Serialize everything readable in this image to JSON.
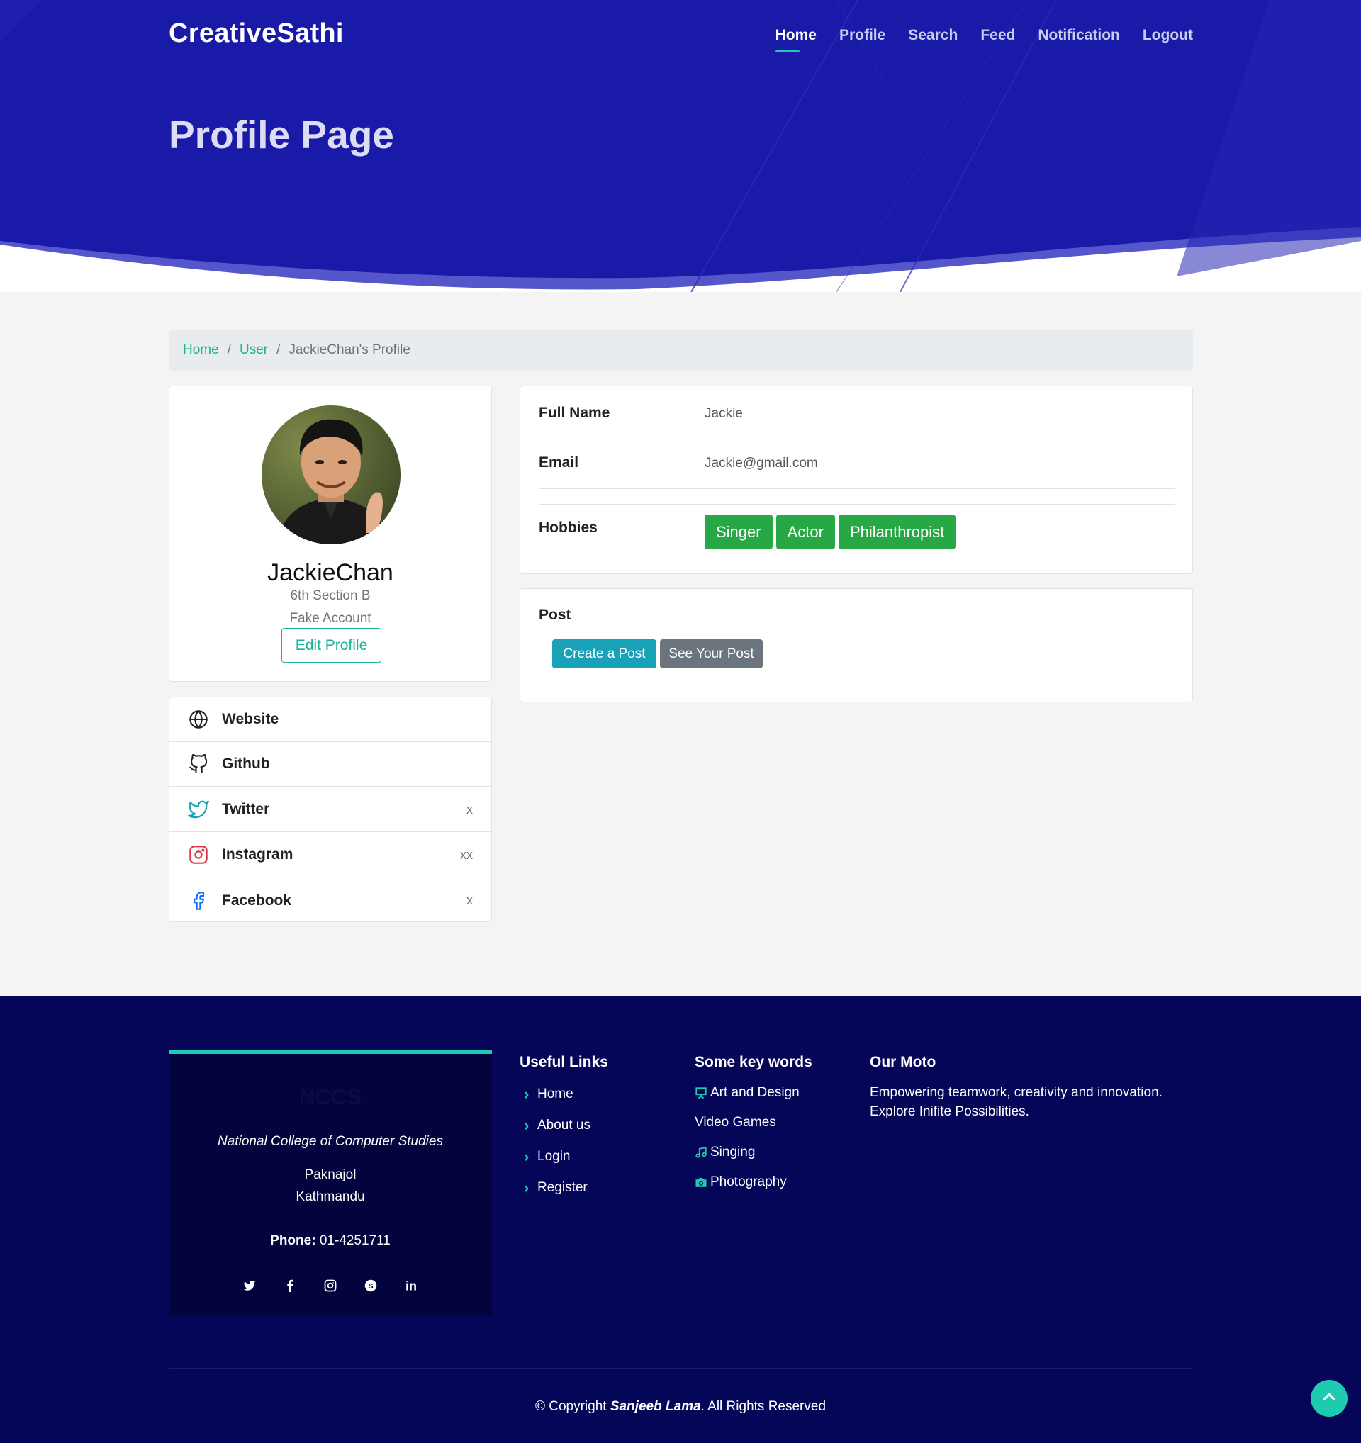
{
  "brand": "CreativeSathi",
  "nav": {
    "items": [
      "Home",
      "Profile",
      "Search",
      "Feed",
      "Notification",
      "Logout"
    ],
    "active": "Home"
  },
  "hero": {
    "title": "Profile Page"
  },
  "breadcrumb": {
    "home": "Home",
    "user": "User",
    "current": "JackieChan's Profile"
  },
  "profile": {
    "name": "JackieChan",
    "section": "6th Section B",
    "note": "Fake Account",
    "edit_label": "Edit Profile"
  },
  "socials": [
    {
      "label": "Website",
      "value": "",
      "icon": "globe-icon"
    },
    {
      "label": "Github",
      "value": "",
      "icon": "github-icon"
    },
    {
      "label": "Twitter",
      "value": "x",
      "icon": "twitter-icon"
    },
    {
      "label": "Instagram",
      "value": "xx",
      "icon": "instagram-icon"
    },
    {
      "label": "Facebook",
      "value": "x",
      "icon": "facebook-icon"
    }
  ],
  "details": {
    "full_name_label": "Full Name",
    "full_name": "Jackie",
    "email_label": "Email",
    "email": "Jackie@gmail.com",
    "hobbies_label": "Hobbies",
    "hobbies": [
      "Singer",
      "Actor",
      "Philanthropist"
    ]
  },
  "post": {
    "title": "Post",
    "create_label": "Create a Post",
    "see_label": "See Your Post"
  },
  "footer": {
    "logo": "NCCS",
    "college": "National College of Computer Studies",
    "address1": "Paknajol",
    "address2": "Kathmandu",
    "phone_label": "Phone:",
    "phone": "01-4251711",
    "social_icons": [
      "twitter-icon",
      "facebook-icon",
      "instagram-icon",
      "skype-icon",
      "linkedin-icon"
    ],
    "links_title": "Useful Links",
    "links": [
      "Home",
      "About us",
      "Login",
      "Register"
    ],
    "keywords_title": "Some key words",
    "keywords": [
      {
        "label": "Art and Design",
        "icon": "easel-icon"
      },
      {
        "label": "Video Games",
        "icon": ""
      },
      {
        "label": "Singing",
        "icon": "music-note-icon"
      },
      {
        "label": "Photography",
        "icon": "camera-icon"
      }
    ],
    "moto_title": "Our Moto",
    "moto": "Empowering teamwork, creativity and innovation. Explore Inifite Possibilities.",
    "copyright_prefix": "© Copyright",
    "copyright_name": "Sanjeeb Lama",
    "copyright_suffix": ". All Rights Reserved"
  },
  "colors": {
    "hero": "#1a1aa8",
    "accent": "#1ecab0",
    "tag": "#28a745",
    "info_button": "#17a2b8",
    "secondary_button": "#6c757d",
    "footer": "#060659"
  }
}
